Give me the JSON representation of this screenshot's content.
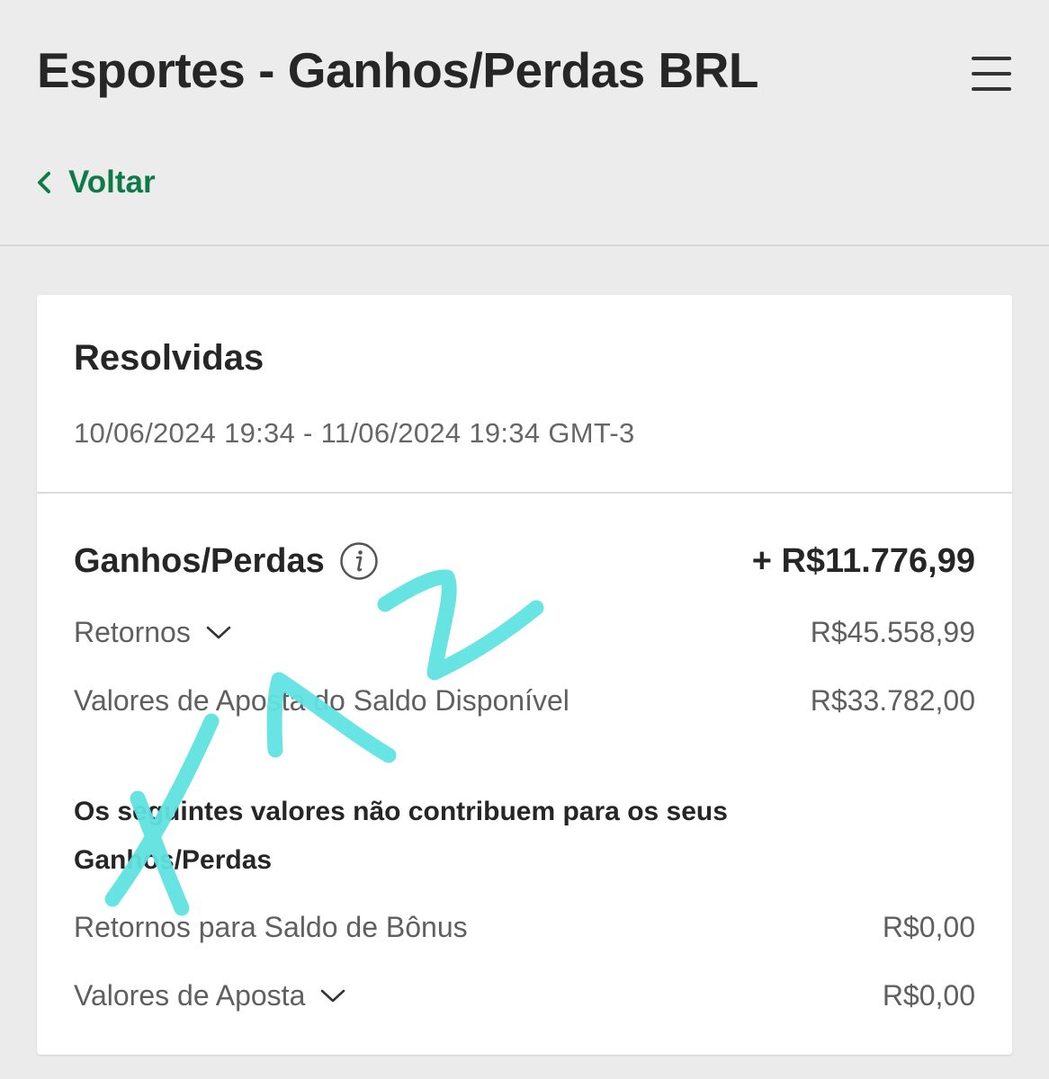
{
  "header": {
    "title": "Esportes - Ganhos/Perdas BRL",
    "back_label": "Voltar"
  },
  "card": {
    "title": "Resolvidas",
    "date_range": "10/06/2024 19:34 - 11/06/2024 19:34 GMT-3",
    "total": {
      "label": "Ganhos/Perdas",
      "value": "+ R$11.776,99"
    },
    "returns": {
      "label": "Retornos",
      "value": "R$45.558,99"
    },
    "stake_values": {
      "label": "Valores de Aposta do Saldo Disponível",
      "value": "R$33.782,00"
    },
    "note": "Os seguintes valores não contribuem para os seus Ganhos/Perdas",
    "bonus_returns": {
      "label": "Retornos para Saldo de Bônus",
      "value": "R$0,00"
    },
    "bonus_stakes": {
      "label": "Valores de Aposta",
      "value": "R$0,00"
    }
  },
  "colors": {
    "accent": "#0d7a48",
    "scribble": "#5fe3e1",
    "background": "#ebebeb",
    "card": "#ffffff"
  },
  "icons": {
    "menu": "hamburger-menu-icon",
    "back": "chevron-left-icon",
    "info": "info-icon",
    "expand": "chevron-down-icon"
  }
}
